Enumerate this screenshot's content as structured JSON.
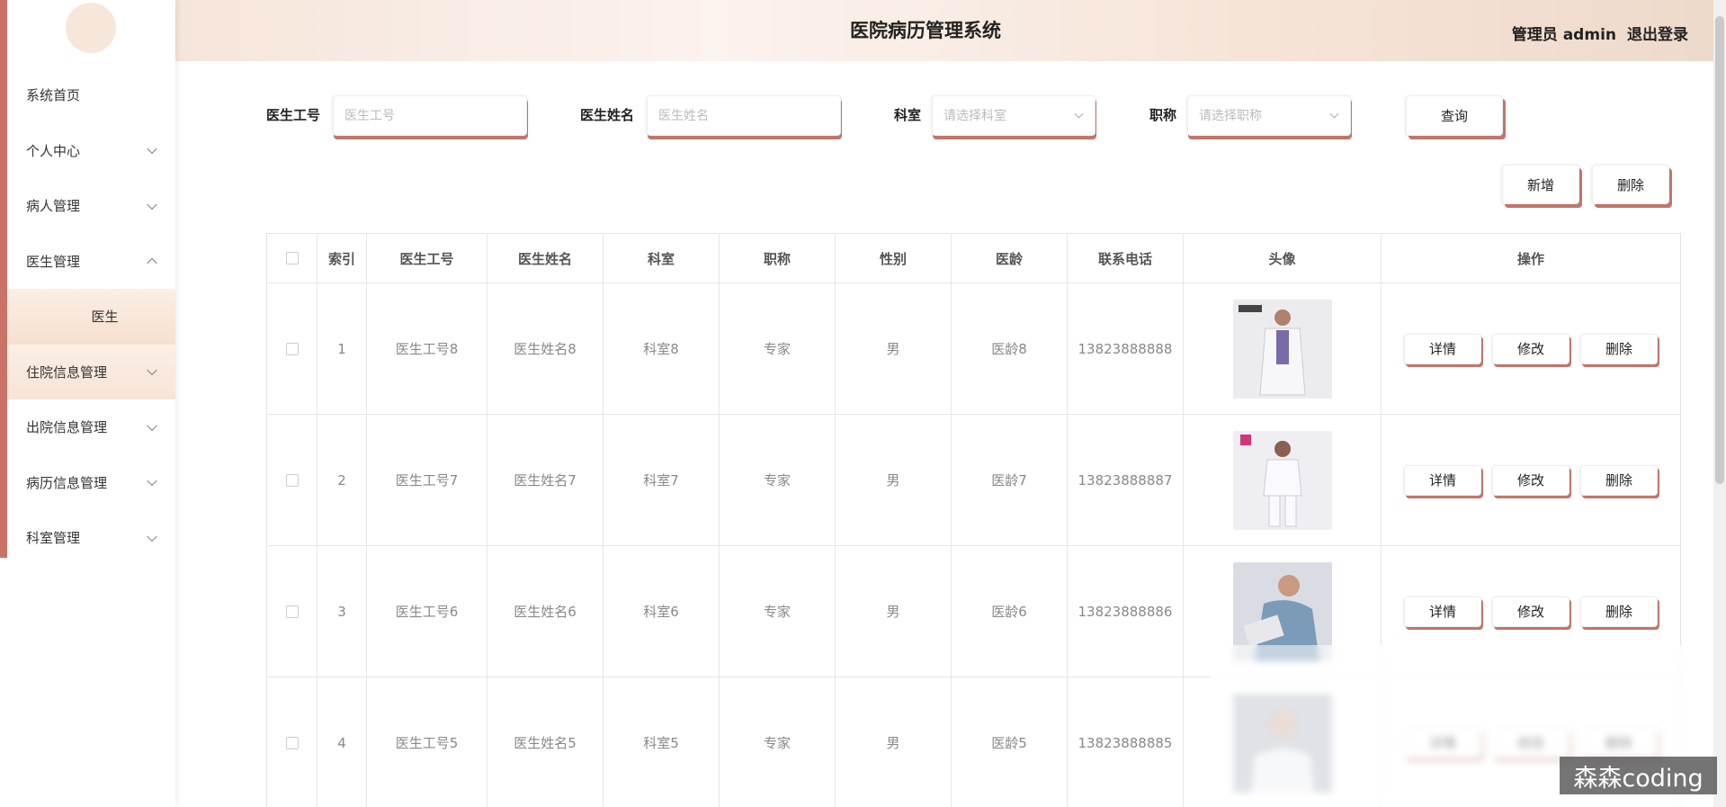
{
  "header": {
    "title": "医院病历管理系统",
    "user_label": "管理员 admin",
    "logout": "退出登录"
  },
  "sidebar": {
    "items": [
      {
        "label": "系统首页"
      },
      {
        "label": "个人中心"
      },
      {
        "label": "病人管理"
      },
      {
        "label": "医生管理"
      },
      {
        "label": "医生"
      },
      {
        "label": "住院信息管理"
      },
      {
        "label": "出院信息管理"
      },
      {
        "label": "病历信息管理"
      },
      {
        "label": "科室管理"
      }
    ]
  },
  "search": {
    "doctor_id_label": "医生工号",
    "doctor_id_placeholder": "医生工号",
    "doctor_name_label": "医生姓名",
    "doctor_name_placeholder": "医生姓名",
    "dept_label": "科室",
    "dept_placeholder": "请选择科室",
    "title_label": "职称",
    "title_placeholder": "请选择职称",
    "query_button": "查询"
  },
  "actions": {
    "add": "新增",
    "delete": "删除"
  },
  "table": {
    "columns": [
      "索引",
      "医生工号",
      "医生姓名",
      "科室",
      "职称",
      "性别",
      "医龄",
      "联系电话",
      "头像",
      "操作"
    ],
    "rows": [
      {
        "index": "1",
        "doctor_id": "医生工号8",
        "doctor_name": "医生姓名8",
        "dept": "科室8",
        "title": "专家",
        "gender": "男",
        "years": "医龄8",
        "phone": "13823888888"
      },
      {
        "index": "2",
        "doctor_id": "医生工号7",
        "doctor_name": "医生姓名7",
        "dept": "科室7",
        "title": "专家",
        "gender": "男",
        "years": "医龄7",
        "phone": "13823888887"
      },
      {
        "index": "3",
        "doctor_id": "医生工号6",
        "doctor_name": "医生姓名6",
        "dept": "科室6",
        "title": "专家",
        "gender": "男",
        "years": "医龄6",
        "phone": "13823888886"
      },
      {
        "index": "4",
        "doctor_id": "医生工号5",
        "doctor_name": "医生姓名5",
        "dept": "科室5",
        "title": "专家",
        "gender": "男",
        "years": "医龄5",
        "phone": "13823888885"
      }
    ],
    "op_detail": "详情",
    "op_edit": "修改",
    "op_delete": "删除"
  },
  "watermark": "森森coding",
  "colors": {
    "accent": "#c2756a",
    "sidebar_strip": "#c87268",
    "header_bg": "#f6e5da"
  }
}
